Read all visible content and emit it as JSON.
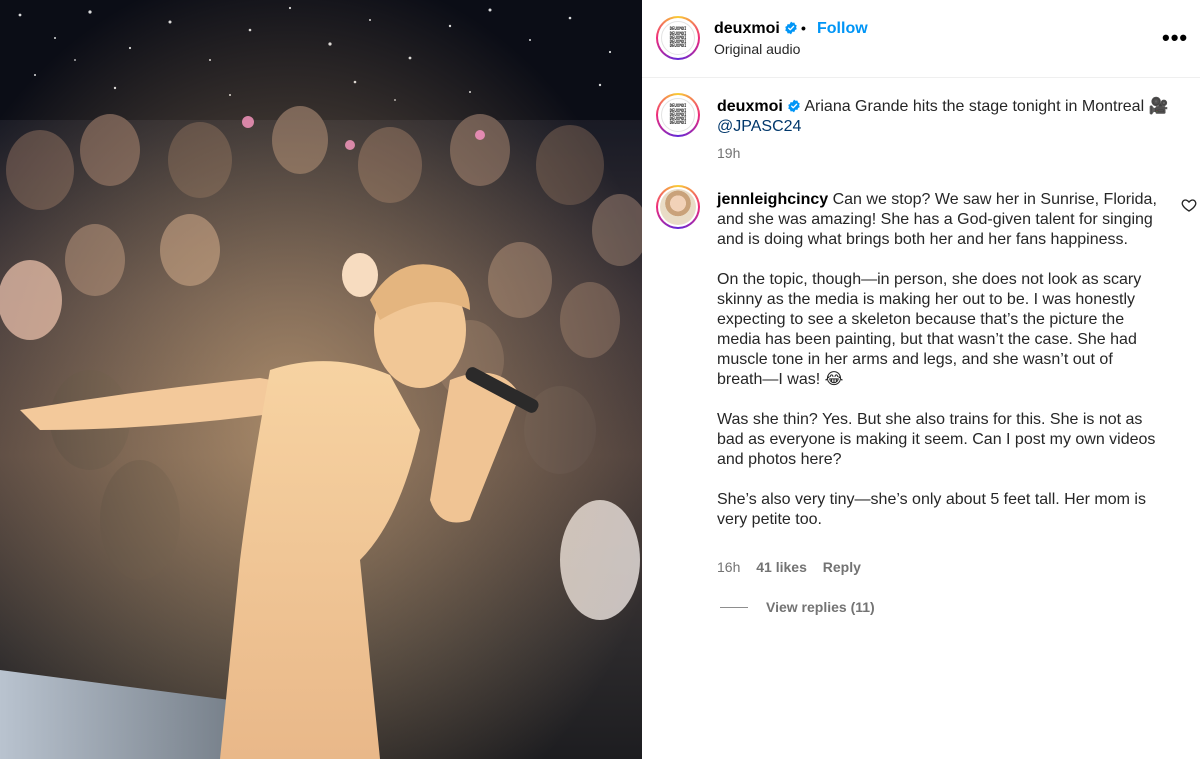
{
  "header": {
    "username": "deuxmoi",
    "separator": "•",
    "follow_label": "Follow",
    "subtitle": "Original audio",
    "more_label": "•••",
    "logo_lines": [
      "DEUXMOI",
      "DEUXMOI",
      "DEUXMOI",
      "DEUXMOI",
      "DEUXMOI"
    ]
  },
  "caption": {
    "username": "deuxmoi",
    "text": "Ariana Grande hits the stage tonight in Montreal",
    "camera_emoji": "🎥",
    "mention": "@JPASC24",
    "time": "19h"
  },
  "comment": {
    "username": "jennleighcincy",
    "paragraph_1": "Can we stop? We saw her in Sunrise, Florida, and she was amazing! She has a God-given talent for singing and is doing what brings both her and her fans happiness.",
    "paragraph_2": "On the topic, though—in person, she does not look as scary skinny as the media is making her out to be. I was honestly expecting to see a skeleton because that’s the picture the media has been painting, but that wasn’t the case. She had muscle tone in her arms and legs, and she wasn’t out of breath—I was! 😂",
    "paragraph_3": "Was she thin? Yes. But she also trains for this. She is not as bad as everyone is making it seem. Can I post my own videos and photos here?",
    "paragraph_4": "She’s also very tiny—she’s only about 5 feet tall. Her mom is very petite too.",
    "time": "16h",
    "likes": "41 likes",
    "reply_label": "Reply",
    "view_replies": "View replies (11)"
  },
  "colors": {
    "link_blue": "#0095f6",
    "mention_blue": "#00376b",
    "secondary_text": "#737373",
    "verified_blue": "#0095f6"
  },
  "icons": [
    "verified-badge-icon",
    "more-options-icon",
    "heart-icon",
    "camera-emoji-icon"
  ]
}
